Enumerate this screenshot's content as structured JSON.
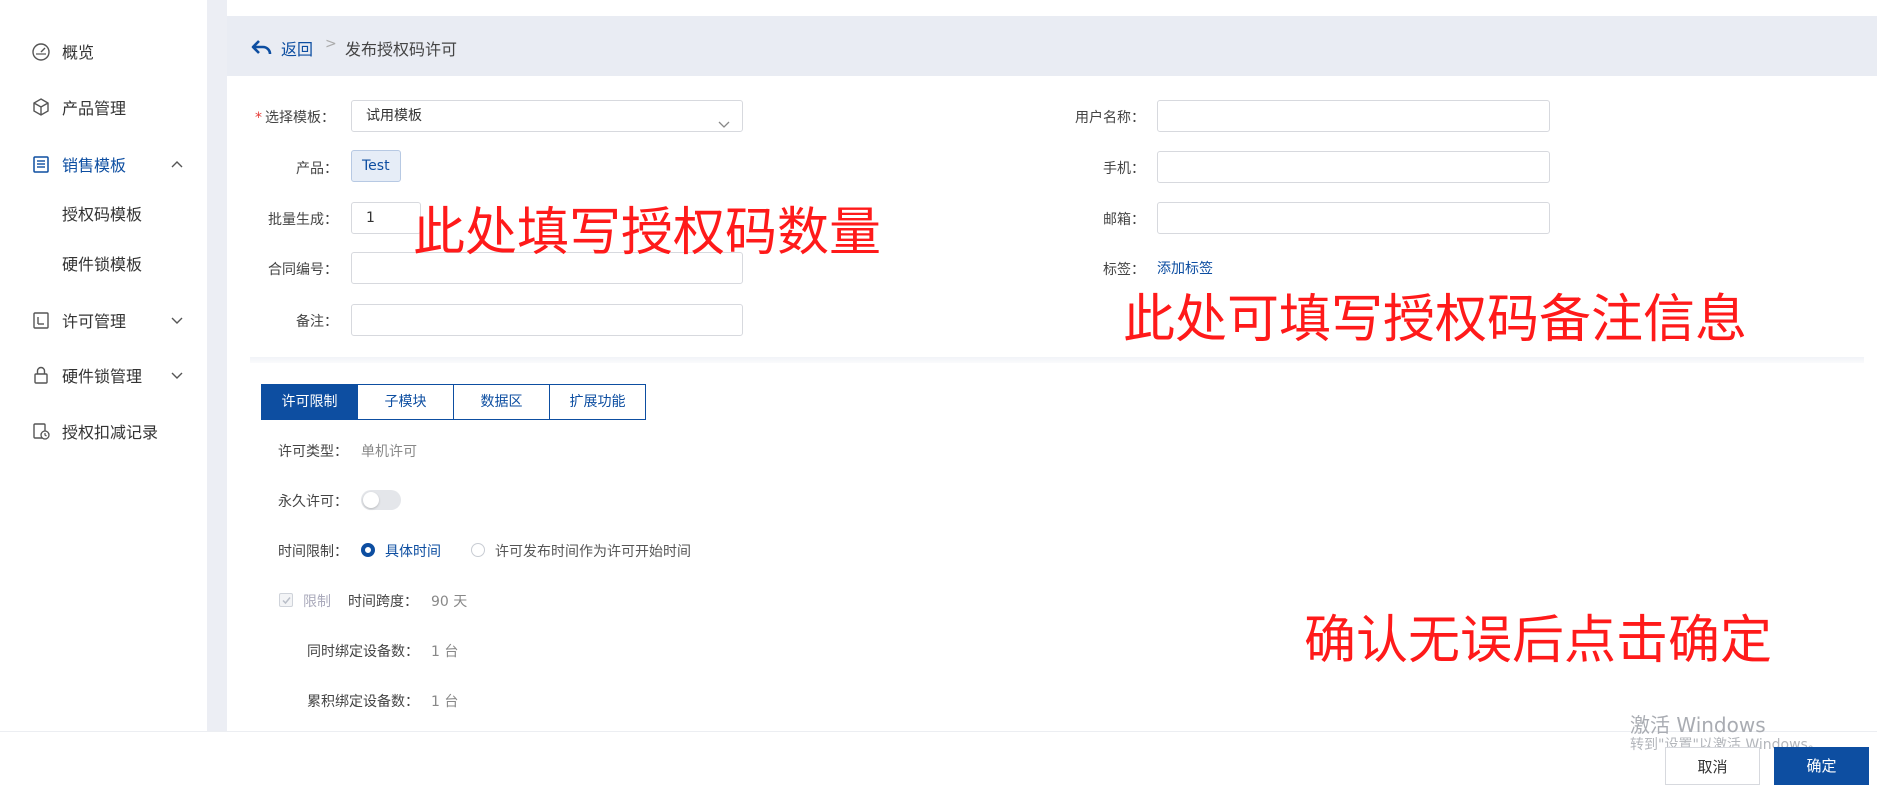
{
  "sidebar": {
    "items": [
      {
        "label": "概览",
        "icon": "dashboard-icon"
      },
      {
        "label": "产品管理",
        "icon": "cube-icon"
      },
      {
        "label": "销售模板",
        "icon": "template-icon",
        "active": true,
        "expanded": true
      },
      {
        "label": "许可管理",
        "icon": "license-icon"
      },
      {
        "label": "硬件锁管理",
        "icon": "lock-icon"
      },
      {
        "label": "授权扣减记录",
        "icon": "record-icon"
      }
    ],
    "sub_items": [
      "授权码模板",
      "硬件锁模板"
    ]
  },
  "header": {
    "back_label": "返回",
    "separator": ">",
    "current": "发布授权码许可"
  },
  "form": {
    "template_label": "选择模板：",
    "template_value": "试用模板",
    "product_label": "产品：",
    "product_value": "Test",
    "batch_label": "批量生成：",
    "batch_value": "1",
    "contract_label": "合同编号：",
    "contract_value": "",
    "remark_label": "备注：",
    "remark_value": "",
    "username_label": "用户名称：",
    "username_value": "",
    "phone_label": "手机：",
    "phone_value": "",
    "email_label": "邮箱：",
    "email_value": "",
    "tags_label": "标签：",
    "add_tag": "添加标签"
  },
  "tabs": [
    "许可限制",
    "子模块",
    "数据区",
    "扩展功能"
  ],
  "license": {
    "type_label": "许可类型：",
    "type_value": "单机许可",
    "permanent_label": "永久许可：",
    "permanent_on": false,
    "time_limit_label": "时间限制：",
    "option_specific": "具体时间",
    "option_publish": "许可发布时间作为许可开始时间",
    "limit_label": "限制",
    "span_label": "时间跨度：",
    "span_value": "90 天",
    "concurrent_label": "同时绑定设备数：",
    "concurrent_value": "1 台",
    "cumulative_label": "累积绑定设备数：",
    "cumulative_value": "1 台"
  },
  "annotations": {
    "quantity": "此处填写授权码数量",
    "remark": "此处可填写授权码备注信息",
    "confirm": "确认无误后点击确定"
  },
  "footer": {
    "cancel": "取消",
    "ok": "确定"
  },
  "watermark": {
    "line1": "激活 Windows",
    "line2": "转到\"设置\"以激活 Windows。"
  },
  "colors": {
    "primary": "#0d4ea1",
    "annotation": "#ff1a1a"
  }
}
